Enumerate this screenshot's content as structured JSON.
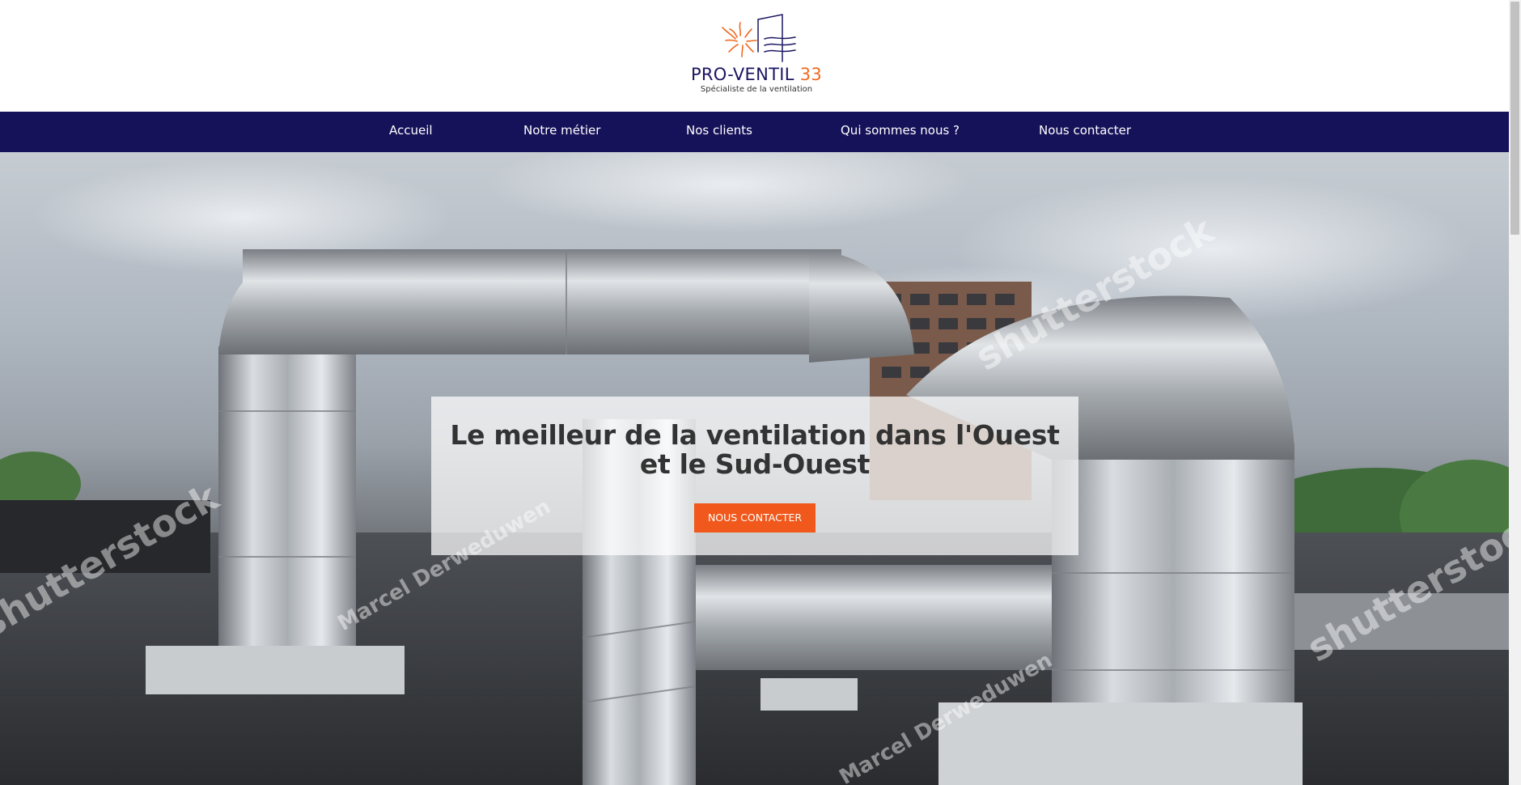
{
  "brand": {
    "name": "PRO-VENTIL",
    "number": "33",
    "tagline": "Spécialiste de la ventilation",
    "logo_icon": "sun-building-icon",
    "primary_color": "#16125a",
    "accent_color": "#ef6a22"
  },
  "nav": {
    "items": [
      {
        "label": "Accueil"
      },
      {
        "label": "Notre métier"
      },
      {
        "label": "Nos clients"
      },
      {
        "label": "Qui sommes nous ?"
      },
      {
        "label": "Nous contacter"
      }
    ]
  },
  "hero": {
    "title": "Le meilleur de la ventilation dans l'Ouest et le Sud-Ouest",
    "cta_label": "NOUS CONTACTER",
    "cta_color": "#f0581c",
    "watermark_brand": "shutterstock",
    "watermark_author": "Marcel Derweduwen"
  }
}
